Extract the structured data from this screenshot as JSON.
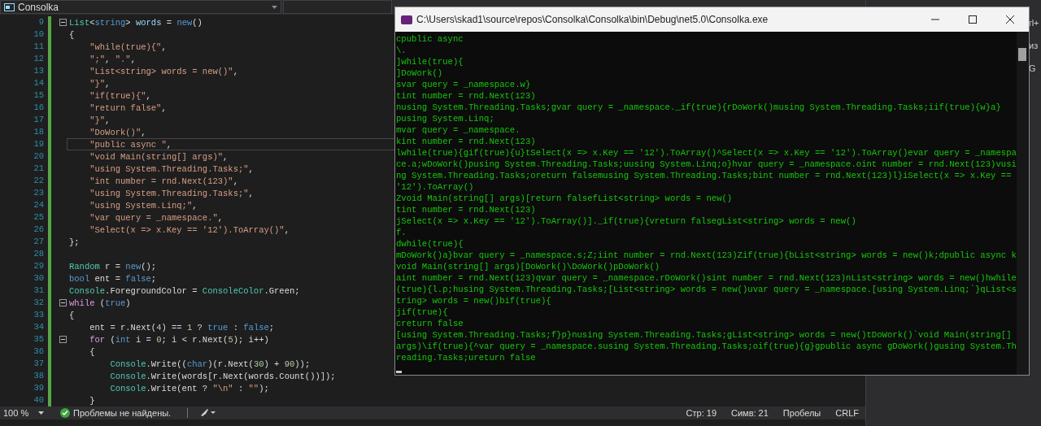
{
  "editor": {
    "project": "Consolka",
    "lines": [
      {
        "number": "9",
        "fold": true,
        "current": false,
        "tokens": [
          {
            "kind": "type",
            "text": "List"
          },
          {
            "kind": "plain",
            "text": "<"
          },
          {
            "kind": "keyword",
            "text": "string"
          },
          {
            "kind": "plain",
            "text": "> "
          },
          {
            "kind": "variable",
            "text": "words"
          },
          {
            "kind": "plain",
            "text": " = "
          },
          {
            "kind": "keyword",
            "text": "new"
          },
          {
            "kind": "plain",
            "text": "()"
          }
        ]
      },
      {
        "number": "10",
        "fold": false,
        "current": false,
        "tokens": [
          {
            "kind": "plain",
            "text": "{"
          }
        ]
      },
      {
        "number": "11",
        "fold": false,
        "current": false,
        "tokens": [
          {
            "kind": "string",
            "text": "    \"while(true){\""
          },
          {
            "kind": "plain",
            "text": ","
          }
        ]
      },
      {
        "number": "12",
        "fold": false,
        "current": false,
        "tokens": [
          {
            "kind": "string",
            "text": "    \";\""
          },
          {
            "kind": "plain",
            "text": ", "
          },
          {
            "kind": "string",
            "text": "\".\""
          },
          {
            "kind": "plain",
            "text": ","
          }
        ]
      },
      {
        "number": "13",
        "fold": false,
        "current": false,
        "tokens": [
          {
            "kind": "string",
            "text": "    \"List<string> words = new()\""
          },
          {
            "kind": "plain",
            "text": ","
          }
        ]
      },
      {
        "number": "14",
        "fold": false,
        "current": false,
        "tokens": [
          {
            "kind": "string",
            "text": "    \"}\""
          },
          {
            "kind": "plain",
            "text": ","
          }
        ]
      },
      {
        "number": "15",
        "fold": false,
        "current": false,
        "tokens": [
          {
            "kind": "string",
            "text": "    \"if(true){\""
          },
          {
            "kind": "plain",
            "text": ","
          }
        ]
      },
      {
        "number": "16",
        "fold": false,
        "current": false,
        "tokens": [
          {
            "kind": "string",
            "text": "    \"return false\""
          },
          {
            "kind": "plain",
            "text": ","
          }
        ]
      },
      {
        "number": "17",
        "fold": false,
        "current": false,
        "tokens": [
          {
            "kind": "string",
            "text": "    \"}\""
          },
          {
            "kind": "plain",
            "text": ","
          }
        ]
      },
      {
        "number": "18",
        "fold": false,
        "current": false,
        "tokens": [
          {
            "kind": "string",
            "text": "    \"DoWork()\""
          },
          {
            "kind": "plain",
            "text": ","
          }
        ]
      },
      {
        "number": "19",
        "fold": false,
        "current": true,
        "tokens": [
          {
            "kind": "string",
            "text": "    \"public async \""
          },
          {
            "kind": "plain",
            "text": ","
          }
        ]
      },
      {
        "number": "20",
        "fold": false,
        "current": false,
        "tokens": [
          {
            "kind": "string",
            "text": "    \"void Main(string[] args)\""
          },
          {
            "kind": "plain",
            "text": ","
          }
        ]
      },
      {
        "number": "21",
        "fold": false,
        "current": false,
        "tokens": [
          {
            "kind": "string",
            "text": "    \"using System.Threading.Tasks;\""
          },
          {
            "kind": "plain",
            "text": ","
          }
        ]
      },
      {
        "number": "22",
        "fold": false,
        "current": false,
        "tokens": [
          {
            "kind": "string",
            "text": "    \"int number = rnd.Next(123)\""
          },
          {
            "kind": "plain",
            "text": ","
          }
        ]
      },
      {
        "number": "23",
        "fold": false,
        "current": false,
        "tokens": [
          {
            "kind": "string",
            "text": "    \"using System.Threading.Tasks;\""
          },
          {
            "kind": "plain",
            "text": ","
          }
        ]
      },
      {
        "number": "24",
        "fold": false,
        "current": false,
        "tokens": [
          {
            "kind": "string",
            "text": "    \"using System.Linq;\""
          },
          {
            "kind": "plain",
            "text": ","
          }
        ]
      },
      {
        "number": "25",
        "fold": false,
        "current": false,
        "tokens": [
          {
            "kind": "string",
            "text": "    \"var query = _namespace.\""
          },
          {
            "kind": "plain",
            "text": ","
          }
        ]
      },
      {
        "number": "26",
        "fold": false,
        "current": false,
        "tokens": [
          {
            "kind": "string",
            "text": "    \"Select(x => x.Key == '12').ToArray()\""
          },
          {
            "kind": "plain",
            "text": ","
          }
        ]
      },
      {
        "number": "27",
        "fold": false,
        "current": false,
        "tokens": [
          {
            "kind": "plain",
            "text": "};"
          }
        ]
      },
      {
        "number": "28",
        "fold": false,
        "current": false
      },
      {
        "number": "29",
        "fold": false,
        "current": false,
        "tokens": [
          {
            "kind": "type",
            "text": "Random"
          },
          {
            "kind": "plain",
            "text": " r = "
          },
          {
            "kind": "keyword",
            "text": "new"
          },
          {
            "kind": "plain",
            "text": "();"
          }
        ]
      },
      {
        "number": "30",
        "fold": false,
        "current": false,
        "tokens": [
          {
            "kind": "keyword",
            "text": "bool"
          },
          {
            "kind": "plain",
            "text": " ent = "
          },
          {
            "kind": "keyword",
            "text": "false"
          },
          {
            "kind": "plain",
            "text": ";"
          }
        ]
      },
      {
        "number": "31",
        "fold": false,
        "current": false,
        "tokens": [
          {
            "kind": "type",
            "text": "Console"
          },
          {
            "kind": "plain",
            "text": ".ForegroundColor = "
          },
          {
            "kind": "type",
            "text": "ConsoleColor"
          },
          {
            "kind": "plain",
            "text": ".Green;"
          }
        ]
      },
      {
        "number": "32",
        "fold": true,
        "current": false,
        "tokens": [
          {
            "kind": "control",
            "text": "while"
          },
          {
            "kind": "plain",
            "text": " ("
          },
          {
            "kind": "keyword",
            "text": "true"
          },
          {
            "kind": "plain",
            "text": ")"
          }
        ]
      },
      {
        "number": "33",
        "fold": false,
        "current": false,
        "tokens": [
          {
            "kind": "plain",
            "text": "{"
          }
        ]
      },
      {
        "number": "34",
        "fold": false,
        "current": false,
        "tokens": [
          {
            "kind": "plain",
            "text": "    ent = r.Next("
          },
          {
            "kind": "number",
            "text": "4"
          },
          {
            "kind": "plain",
            "text": ") == "
          },
          {
            "kind": "number",
            "text": "1"
          },
          {
            "kind": "plain",
            "text": " ? "
          },
          {
            "kind": "keyword",
            "text": "true"
          },
          {
            "kind": "plain",
            "text": " : "
          },
          {
            "kind": "keyword",
            "text": "false"
          },
          {
            "kind": "plain",
            "text": ";"
          }
        ]
      },
      {
        "number": "35",
        "fold": true,
        "current": false,
        "tokens": [
          {
            "kind": "control",
            "text": "    for"
          },
          {
            "kind": "plain",
            "text": " ("
          },
          {
            "kind": "keyword",
            "text": "int"
          },
          {
            "kind": "plain",
            "text": " i = "
          },
          {
            "kind": "number",
            "text": "0"
          },
          {
            "kind": "plain",
            "text": "; i < r.Next("
          },
          {
            "kind": "number",
            "text": "5"
          },
          {
            "kind": "plain",
            "text": "); i++)"
          }
        ]
      },
      {
        "number": "36",
        "fold": false,
        "current": false,
        "tokens": [
          {
            "kind": "plain",
            "text": "    {"
          }
        ]
      },
      {
        "number": "37",
        "fold": false,
        "current": false,
        "tokens": [
          {
            "kind": "type",
            "text": "        Console"
          },
          {
            "kind": "plain",
            "text": ".Write(("
          },
          {
            "kind": "keyword",
            "text": "char"
          },
          {
            "kind": "plain",
            "text": ")(r.Next("
          },
          {
            "kind": "number",
            "text": "30"
          },
          {
            "kind": "plain",
            "text": ") + "
          },
          {
            "kind": "number",
            "text": "90"
          },
          {
            "kind": "plain",
            "text": "));"
          }
        ]
      },
      {
        "number": "38",
        "fold": false,
        "current": false,
        "tokens": [
          {
            "kind": "type",
            "text": "        Console"
          },
          {
            "kind": "plain",
            "text": ".Write(words[r.Next(words.Count())]);"
          }
        ]
      },
      {
        "number": "39",
        "fold": false,
        "current": false,
        "tokens": [
          {
            "kind": "type",
            "text": "        Console"
          },
          {
            "kind": "plain",
            "text": ".Write(ent ? "
          },
          {
            "kind": "string",
            "text": "\"\\n\""
          },
          {
            "kind": "plain",
            "text": " : "
          },
          {
            "kind": "string",
            "text": "\"\""
          },
          {
            "kind": "plain",
            "text": ");"
          }
        ]
      },
      {
        "number": "40",
        "fold": false,
        "current": false,
        "tokens": [
          {
            "kind": "plain",
            "text": "    }"
          }
        ]
      }
    ]
  },
  "console": {
    "title": "C:\\Users\\skad1\\source\\repos\\Consolka\\Consolka\\bin\\Debug\\net5.0\\Consolka.exe",
    "lines": [
      "cpublic async",
      "\\.",
      "]while(true){",
      "]DoWork()",
      "svar query = _namespace.w}",
      "tint number = rnd.Next(123)",
      "nusing System.Threading.Tasks;gvar query = _namespace._if(true){rDoWork()musing System.Threading.Tasks;iif(true){w}a}",
      "pusing System.Linq;",
      "mvar query = _namespace.",
      "kint number = rnd.Next(123)",
      "lwhile(true){gif(true){u}tSelect(x => x.Key == '12').ToArray()^Select(x => x.Key == '12').ToArray()evar query = _namespa",
      "ce.a;wDoWork()pusing System.Threading.Tasks;uusing System.Linq;o}hvar query = _namespace.oint number = rnd.Next(123)vusi",
      "ng System.Threading.Tasks;oreturn falsemusing System.Threading.Tasks;bint number = rnd.Next(123)l}iSelect(x => x.Key ==",
      "'12').ToArray()",
      "Zvoid Main(string[] args)[return falsefList<string> words = new()",
      "tint number = rnd.Next(123)",
      "jSelect(x => x.Key == '12').ToArray()]._if(true){vreturn falsegList<string> words = new()",
      "f.",
      "dwhile(true){",
      "mDoWork()a}bvar query = _namespace.s;Z;iint number = rnd.Next(123)Zif(true){bList<string> words = new()k;dpublic async k",
      "void Main(string[] args)[DoWork()\\DoWork()pDoWork()",
      "aint number = rnd.Next(123)qvar query = _namespace.rDoWork()sint number = rnd.Next(123)nList<string> words = new()hwhile",
      "(true){l.p;husing System.Threading.Tasks;[List<string> words = new()uvar query = _namespace.[using System.Linq;`}qList<s",
      "tring> words = new()bif(true){",
      "jif(true){",
      "creturn false",
      "[using System.Threading.Tasks;f}p}nusing System.Threading.Tasks;gList<string> words = new()tDoWork()`void Main(string[]",
      "args)\\if(true){^var query = _namespace.susing System.Threading.Tasks;oif(true){g}gpublic async gDoWork()gusing System.Th",
      "reading.Tasks;ureturn false"
    ]
  },
  "side_panel": [
    "rl+",
    "из",
    "G"
  ],
  "status_bar": {
    "zoom": "100 %",
    "problems": "Проблемы не найдены.",
    "line": "Стр: 19",
    "column": "Симв: 21",
    "indent": "Пробелы",
    "line_ending": "CRLF"
  }
}
